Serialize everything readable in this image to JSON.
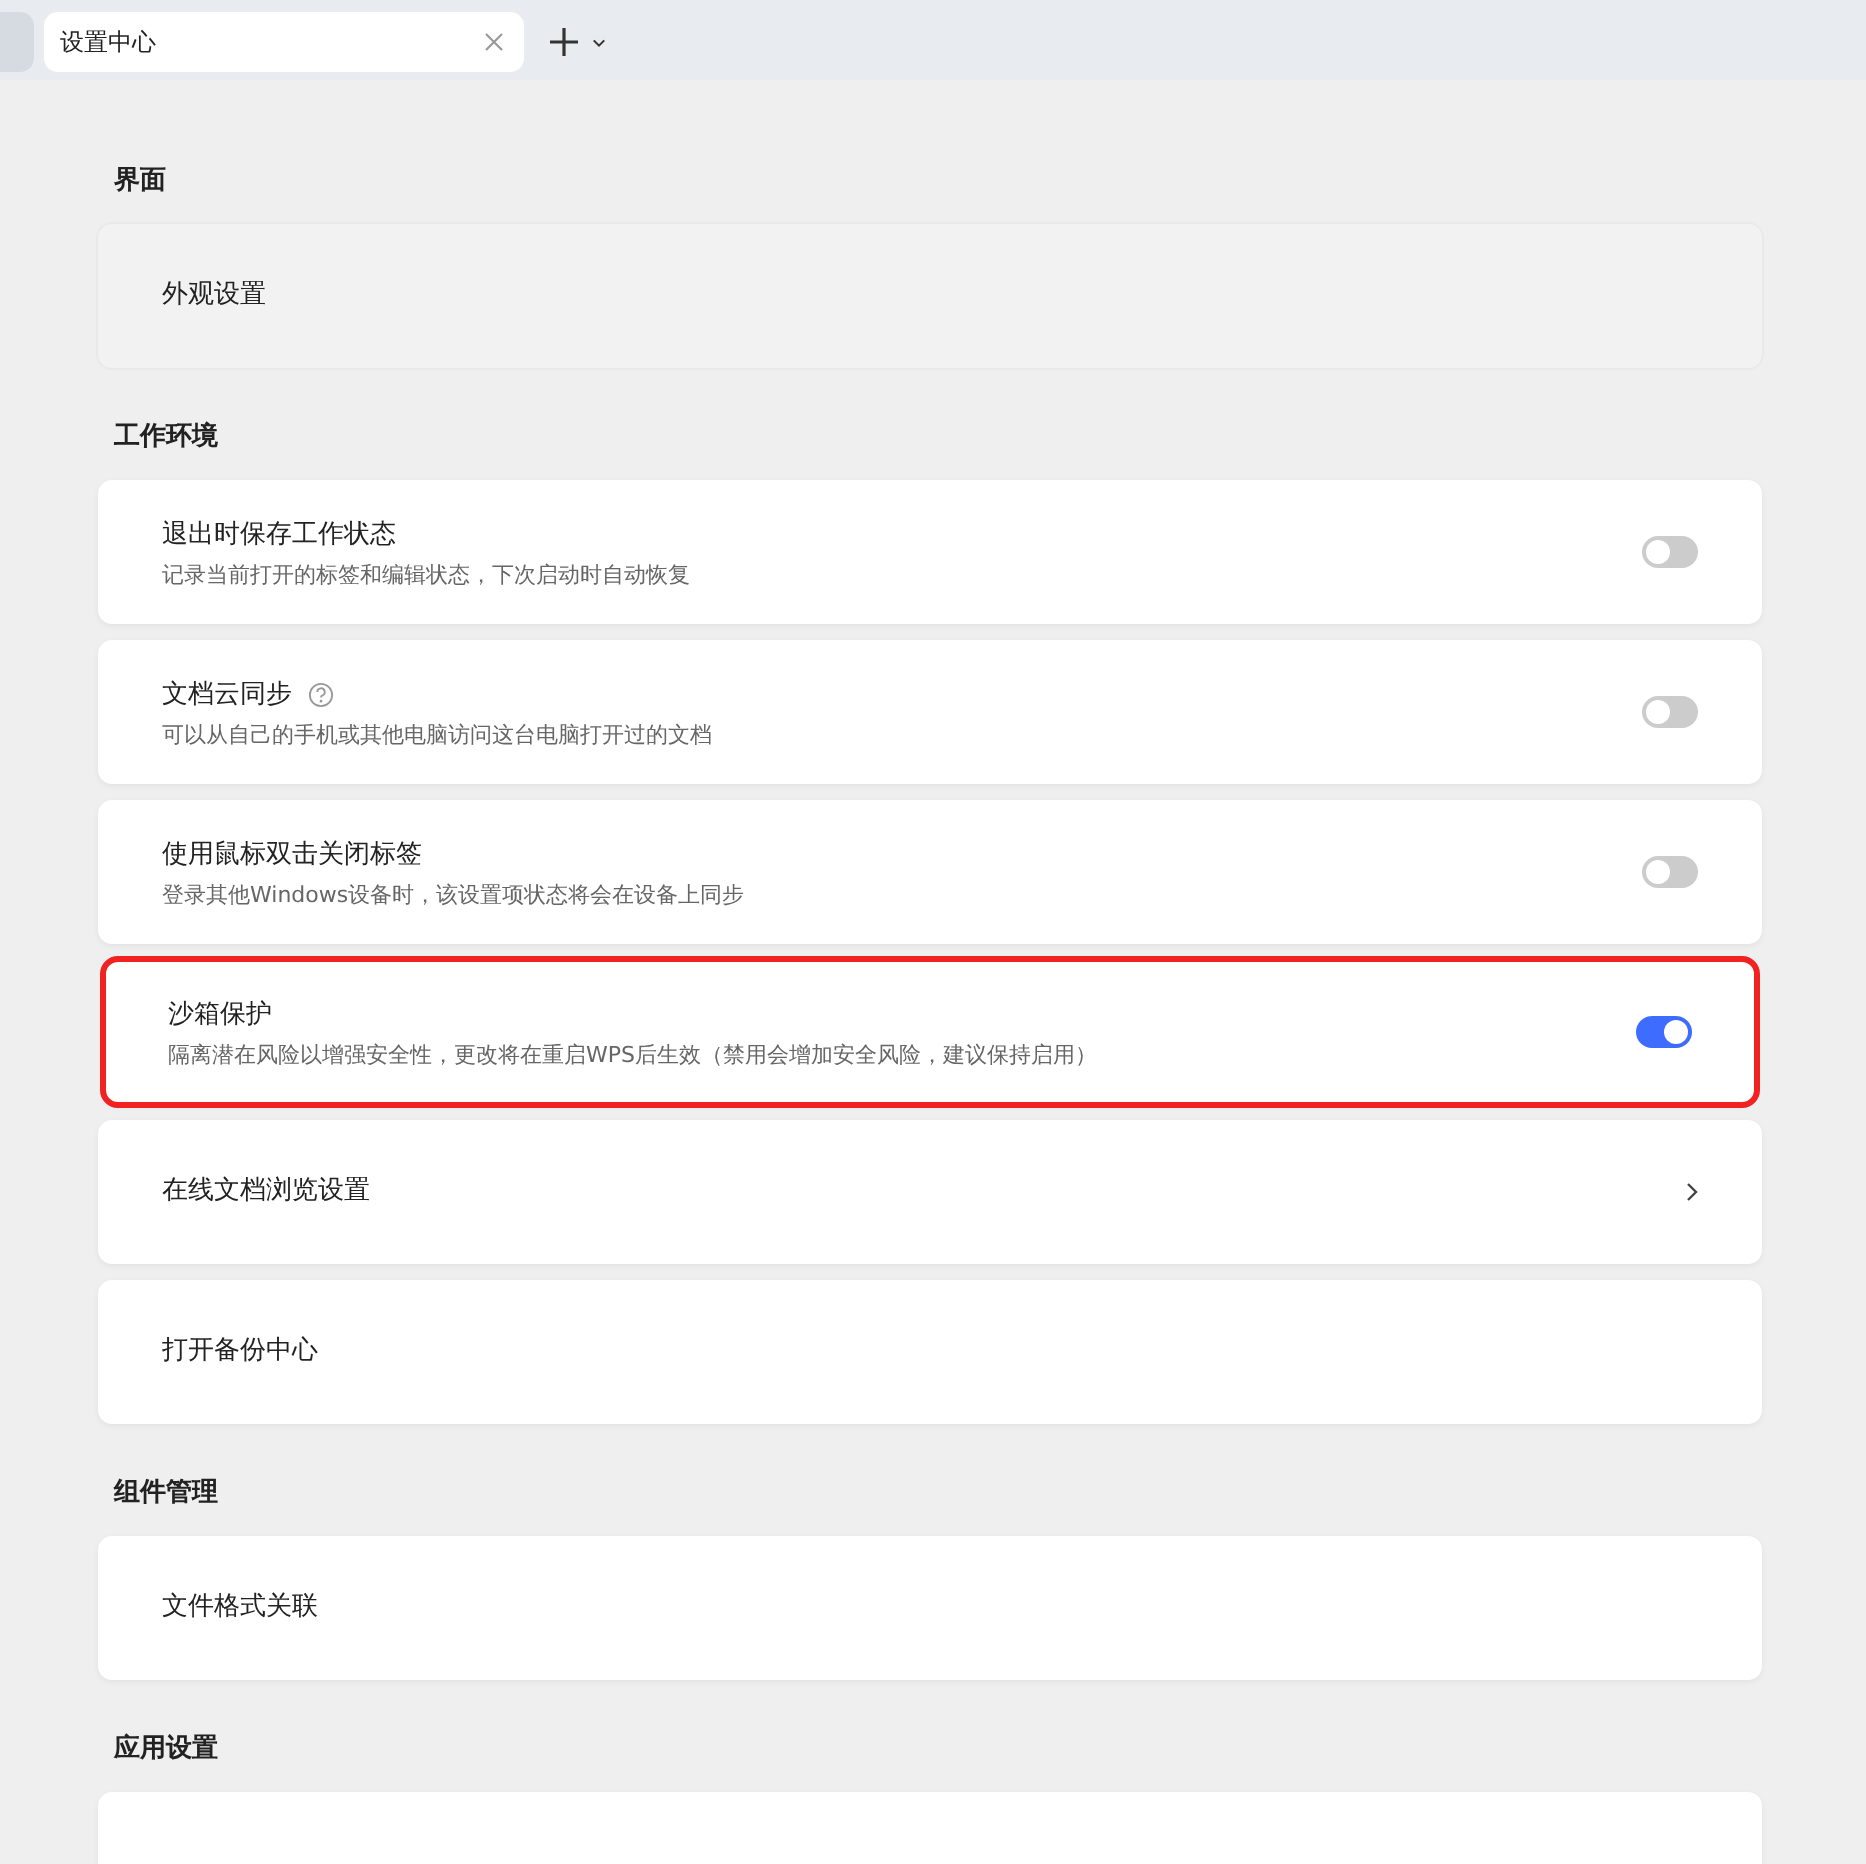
{
  "tabs": [
    {
      "selected": false
    },
    {
      "label": "设置中心",
      "selected": true
    }
  ],
  "sections": [
    {
      "title": "界面",
      "rows": [
        {
          "kind": "plain",
          "title": "外观设置",
          "hovered": true
        }
      ]
    },
    {
      "title": "工作环境",
      "rows": [
        {
          "kind": "toggle",
          "title": "退出时保存工作状态",
          "description": "记录当前打开的标签和编辑状态，下次启动时自动恢复",
          "on": false
        },
        {
          "kind": "toggle",
          "title": "文档云同步",
          "help": true,
          "description": "可以从自己的手机或其他电脑访问这台电脑打开过的文档",
          "on": false
        },
        {
          "kind": "toggle",
          "title": "使用鼠标双击关闭标签",
          "description": "登录其他Windows设备时，该设置项状态将会在设备上同步",
          "on": false
        },
        {
          "kind": "toggle",
          "title": "沙箱保护",
          "description": "隔离潜在风险以增强安全性，更改将在重启WPS后生效（禁用会增加安全风险，建议保持启用）",
          "on": true,
          "highlighted": true
        },
        {
          "kind": "link",
          "title": "在线文档浏览设置"
        },
        {
          "kind": "plain",
          "title": "打开备份中心"
        }
      ]
    },
    {
      "title": "组件管理",
      "rows": [
        {
          "kind": "plain",
          "title": "文件格式关联"
        }
      ]
    },
    {
      "title": "应用设置",
      "rows": [
        {
          "kind": "plain"
        }
      ]
    }
  ]
}
